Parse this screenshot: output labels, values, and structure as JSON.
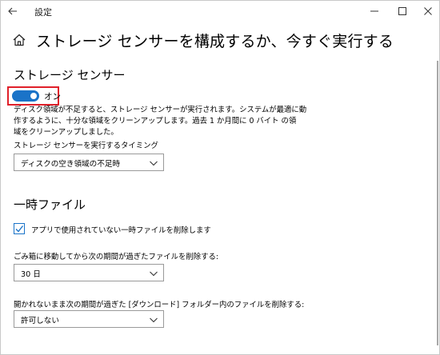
{
  "window": {
    "title": "設定"
  },
  "page": {
    "title": "ストレージ センサーを構成するか、今すぐ実行する"
  },
  "storage_sense": {
    "section_title": "ストレージ センサー",
    "toggle_state": "on",
    "toggle_label": "オン",
    "toggle_color": "#1a73c8",
    "highlight_color": "#e0202a",
    "description_lines": [
      "ディスク領域が不足すると、ストレージ センサーが実行されます。システムが最適に動",
      "作するように、十分な領域をクリーンアップします。過去 1 か月間に 0 バイト の領",
      "域をクリーンアップしました。"
    ],
    "run_timing_label": "ストレージ センサーを実行するタイミング",
    "run_timing_value": "ディスクの空き領域の不足時"
  },
  "temp_files": {
    "section_title": "一時ファイル",
    "delete_temp_checkbox_checked": true,
    "delete_temp_label": "アプリで使用されていない一時ファイルを削除します",
    "recycle_bin_label": "ごみ箱に移動してから次の期間が過ぎたファイルを削除する:",
    "recycle_bin_value": "30 日",
    "downloads_label": "開かれないまま次の期間が過ぎた [ダウンロード] フォルダー内のファイルを削除する:",
    "downloads_value": "許可しない"
  },
  "icons": {
    "back": "back-arrow-icon",
    "home": "home-icon",
    "minimize": "minimize-icon",
    "maximize": "maximize-icon",
    "close": "close-icon",
    "chevron": "chevron-down-icon",
    "check": "checkmark-icon"
  }
}
